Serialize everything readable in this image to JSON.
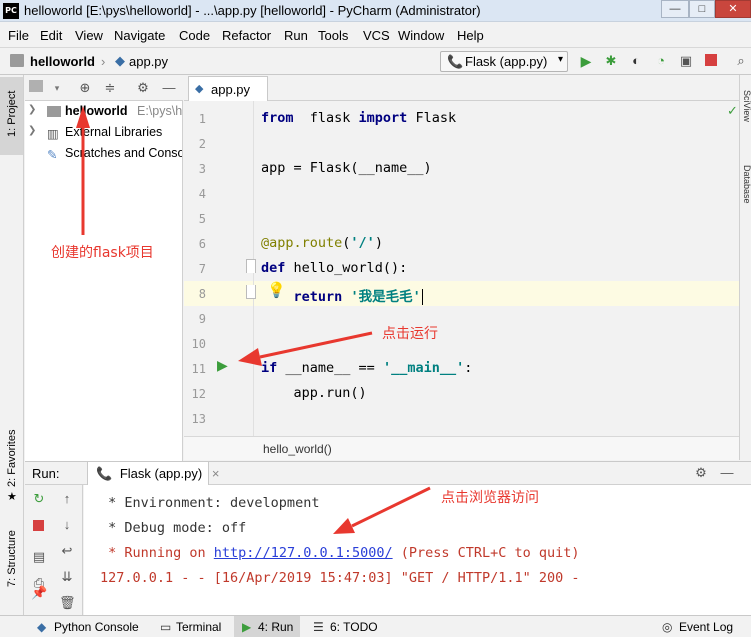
{
  "window": {
    "app_logo": "PC",
    "title": "helloworld [E:\\pys\\helloworld] - ...\\app.py [helloworld] - PyCharm (Administrator)",
    "controls": {
      "minimize": "—",
      "maximize": "□",
      "close": "✕"
    }
  },
  "menu": [
    "File",
    "Edit",
    "View",
    "Navigate",
    "Code",
    "Refactor",
    "Run",
    "Tools",
    "VCS",
    "Window",
    "Help"
  ],
  "navbar": {
    "project": "helloworld",
    "file": "app.py",
    "run_config": "Flask (app.py)"
  },
  "left_tabs": {
    "project": "1: Project",
    "favorites": "2: Favorites",
    "structure": "7: Structure"
  },
  "right_tabs": {
    "scview": "SciView",
    "database": "Database"
  },
  "project_tree": [
    {
      "label": "helloworld",
      "path": "E:\\pys\\h"
    },
    {
      "label": "External Libraries"
    },
    {
      "label": "Scratches and Conso"
    }
  ],
  "editor": {
    "tab": "app.py",
    "line_numbers": [
      "1",
      "2",
      "3",
      "4",
      "5",
      "6",
      "7",
      "8",
      "9",
      "10",
      "11",
      "12",
      "13"
    ],
    "lines": [
      {
        "n": 1,
        "parts": [
          [
            "kw",
            "from"
          ],
          [
            "",
            "  flask "
          ],
          [
            "kw",
            "import"
          ],
          [
            "",
            " Flask"
          ]
        ]
      },
      {
        "n": 3,
        "parts": [
          [
            "",
            "app = Flask(__name__)"
          ]
        ]
      },
      {
        "n": 6,
        "parts": [
          [
            "dec",
            "@app.route"
          ],
          [
            "",
            "("
          ],
          [
            "str",
            "'/'"
          ],
          [
            "",
            ")"
          ]
        ]
      },
      {
        "n": 7,
        "parts": [
          [
            "kw",
            "def"
          ],
          [
            "",
            " hello_world():"
          ]
        ]
      },
      {
        "n": 8,
        "parts": [
          [
            "",
            "    "
          ],
          [
            "kw",
            "return"
          ],
          [
            "",
            " "
          ],
          [
            "str",
            "'我是毛毛'"
          ]
        ]
      },
      {
        "n": 11,
        "parts": [
          [
            "kw",
            "if"
          ],
          [
            "",
            " __name__ == "
          ],
          [
            "str",
            "'__main__'"
          ],
          [
            "",
            ":"
          ]
        ]
      },
      {
        "n": 12,
        "parts": [
          [
            "",
            "    app.run()"
          ]
        ]
      }
    ],
    "breadcrumb": "hello_world()"
  },
  "run_panel": {
    "label": "Run:",
    "tab": "Flask (app.py)",
    "console": {
      "env": " * Environment: development",
      "debug": " * Debug mode: off",
      "running_prefix": " * Running on ",
      "url": "http://127.0.0.1:5000/",
      "running_suffix": " (Press CTRL+C to quit)",
      "request": "127.0.0.1 - - [16/Apr/2019 15:47:03] \"GET / HTTP/1.1\" 200 -"
    }
  },
  "statusbar": {
    "python_console": "Python Console",
    "terminal": "Terminal",
    "run": "4: Run",
    "todo": "6: TODO",
    "event_log": "Event Log"
  },
  "annotations": {
    "project": "创建的flask项目",
    "run": "点击运行",
    "browser": "点击浏览器访问"
  },
  "colors": {
    "keyword": "#000080",
    "string": "#008080",
    "decorator": "#808000",
    "annotation": "#e8382f",
    "run_green": "#3c9d3c",
    "link": "#2a3fd8"
  }
}
